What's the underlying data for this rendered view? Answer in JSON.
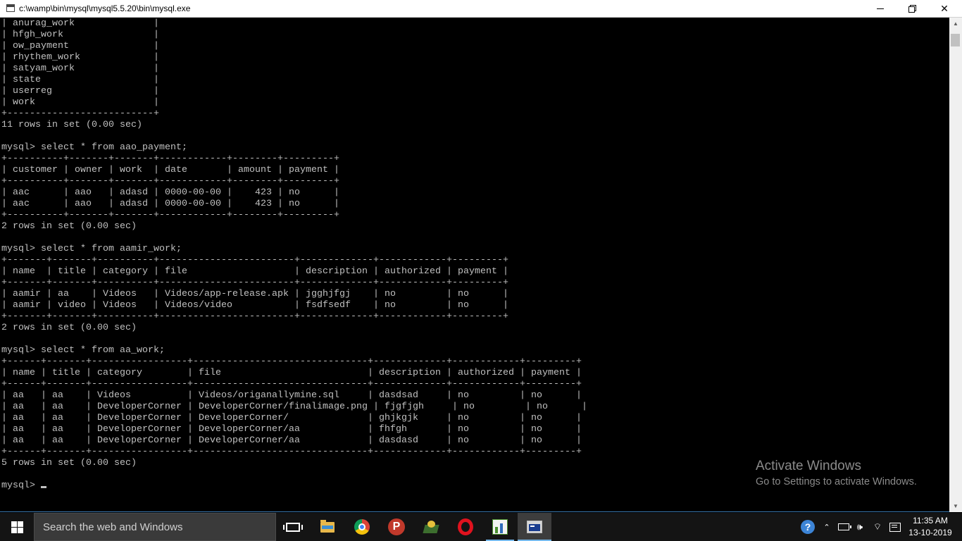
{
  "window": {
    "title": "c:\\wamp\\bin\\mysql\\mysql5.5.20\\bin\\mysql.exe",
    "minimize_label": "",
    "maximize_label": "",
    "close_label": "✕"
  },
  "console": {
    "lines": [
      "| anurag_work              |",
      "| hfgh_work                |",
      "| ow_payment               |",
      "| rhythem_work             |",
      "| satyam_work              |",
      "| state                    |",
      "| userreg                  |",
      "| work                     |",
      "+--------------------------+",
      "11 rows in set (0.00 sec)",
      "",
      "mysql> select * from aao_payment;",
      "+----------+-------+-------+------------+--------+---------+",
      "| customer | owner | work  | date       | amount | payment |",
      "+----------+-------+-------+------------+--------+---------+",
      "| aac      | aao   | adasd | 0000-00-00 |    423 | no      |",
      "| aac      | aao   | adasd | 0000-00-00 |    423 | no      |",
      "+----------+-------+-------+------------+--------+---------+",
      "2 rows in set (0.00 sec)",
      "",
      "mysql> select * from aamir_work;",
      "+-------+-------+----------+------------------------+-------------+------------+---------+",
      "| name  | title | category | file                   | description | authorized | payment |",
      "+-------+-------+----------+------------------------+-------------+------------+---------+",
      "| aamir | aa    | Videos   | Videos/app-release.apk | jgghjfgj    | no         | no      |",
      "| aamir | video | Videos   | Videos/video           | fsdfsedf    | no         | no      |",
      "+-------+-------+----------+------------------------+-------------+------------+---------+",
      "2 rows in set (0.00 sec)",
      "",
      "mysql> select * from aa_work;",
      "+------+-------+-----------------+-------------------------------+-------------+------------+---------+",
      "| name | title | category        | file                          | description | authorized | payment |",
      "+------+-------+-----------------+-------------------------------+-------------+------------+---------+",
      "| aa   | aa    | Videos          | Videos/origanallymine.sql     | dasdsad     | no         | no      |",
      "| aa   | aa    | DeveloperCorner | DeveloperCorner/finalimage.png | fjgfjgh     | no         | no      |",
      "| aa   | aa    | DeveloperCorner | DeveloperCorner/              | ghjkgjk     | no         | no      |",
      "| aa   | aa    | DeveloperCorner | DeveloperCorner/aa            | fhfgh       | no         | no      |",
      "| aa   | aa    | DeveloperCorner | DeveloperCorner/aa            | dasdasd     | no         | no      |",
      "+------+-------+-----------------+-------------------------------+-------------+------------+---------+",
      "5 rows in set (0.00 sec)",
      ""
    ],
    "prompt": "mysql> "
  },
  "watermark": {
    "heading": "Activate Windows",
    "subtext": "Go to Settings to activate Windows."
  },
  "taskbar": {
    "search_placeholder": "Search the web and Windows",
    "apps": [
      {
        "name": "task-view-icon"
      },
      {
        "name": "file-explorer-icon"
      },
      {
        "name": "chrome-icon"
      },
      {
        "name": "psiphon-icon",
        "glyph": "P"
      },
      {
        "name": "green-app-icon"
      },
      {
        "name": "opera-icon"
      },
      {
        "name": "chart-app-icon"
      },
      {
        "name": "console-app-icon"
      }
    ],
    "tray": {
      "help_glyph": "?",
      "chevron": "⌃",
      "volume": "🕪",
      "wifi": "⌔"
    },
    "clock": {
      "time": "11:35 AM",
      "date": "13-10-2019"
    }
  }
}
